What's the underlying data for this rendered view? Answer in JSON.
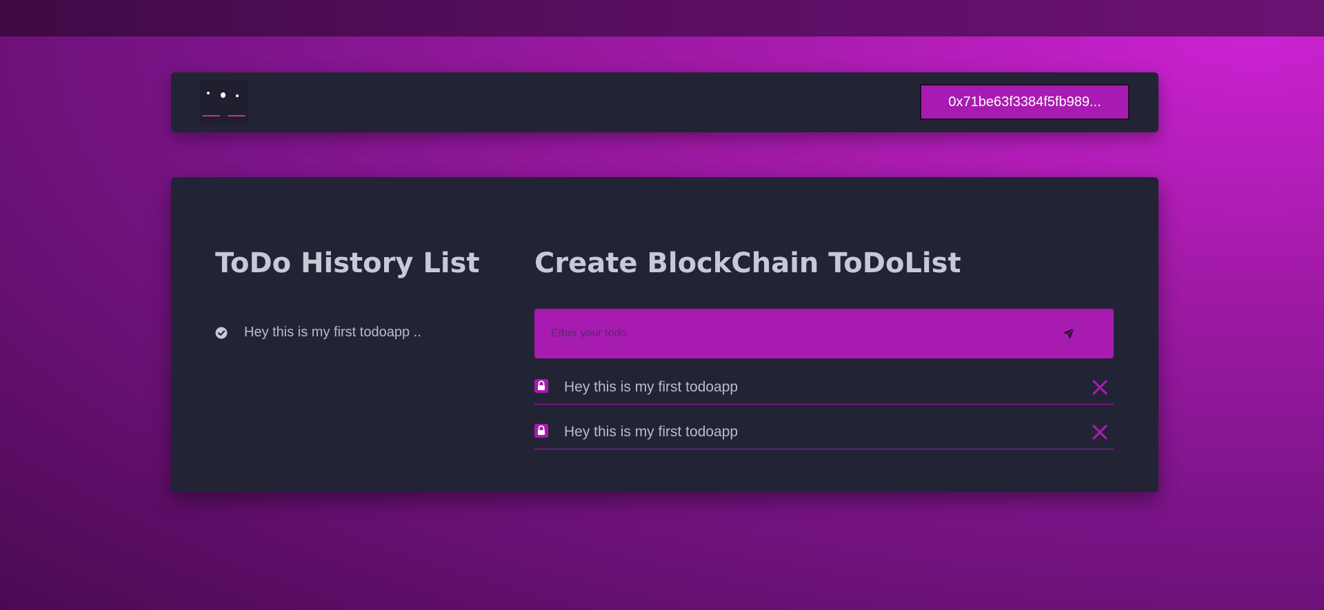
{
  "wallet": {
    "address_label": "0x71be63f3384f5fb989..."
  },
  "history": {
    "title": "ToDo History List",
    "items": [
      {
        "text": "Hey this is my first todoapp .."
      }
    ]
  },
  "create": {
    "title": "Create BlockChain ToDoList",
    "input": {
      "placeholder": "Ether your todo",
      "value": ""
    },
    "todos": [
      {
        "text": "Hey this is my first todoapp"
      },
      {
        "text": "Hey this is my first todoapp"
      }
    ]
  },
  "colors": {
    "accent": "#a81bb0",
    "card": "#232336",
    "text": "#c7c9d6"
  },
  "icons": {
    "logo": "logo-icon",
    "history_check": "check-circle-icon",
    "send": "send-icon",
    "todo_lock": "lock-icon",
    "todo_delete": "close-icon"
  }
}
